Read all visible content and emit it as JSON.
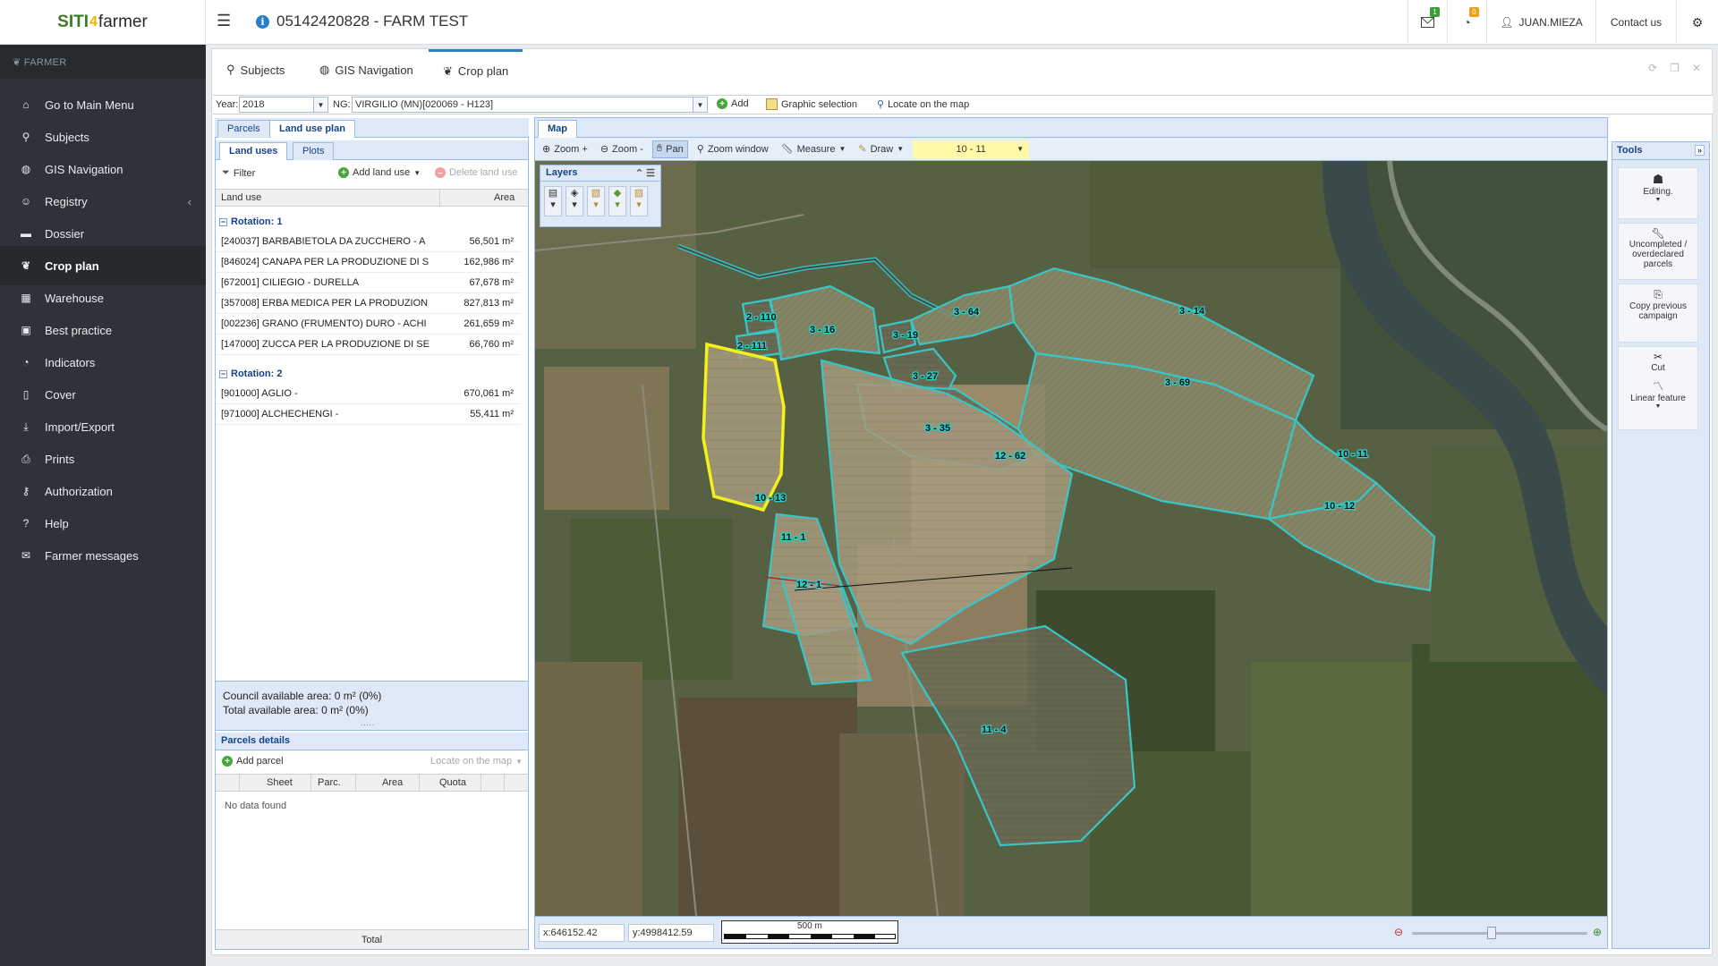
{
  "app": {
    "logo_left": "SITI",
    "logo_mid": "4",
    "logo_right": "farmer",
    "farm_title": "05142420828 - FARM TEST",
    "mail_badge": "1",
    "rss_badge": "0",
    "user": "JUAN.MIEZA",
    "contact": "Contact us"
  },
  "sidebar": {
    "header": "FARMER",
    "items": [
      {
        "label": "Go to Main Menu",
        "icon": "home-icon"
      },
      {
        "label": "Subjects",
        "icon": "search-icon"
      },
      {
        "label": "GIS Navigation",
        "icon": "globe-icon"
      },
      {
        "label": "Registry",
        "icon": "users-icon"
      },
      {
        "label": "Dossier",
        "icon": "folder-icon"
      },
      {
        "label": "Crop plan",
        "icon": "leaf-icon"
      },
      {
        "label": "Warehouse",
        "icon": "warehouse-icon"
      },
      {
        "label": "Best practice",
        "icon": "calendar-check-icon"
      },
      {
        "label": "Indicators",
        "icon": "pie-chart-icon"
      },
      {
        "label": "Cover",
        "icon": "bookmark-icon"
      },
      {
        "label": "Import/Export",
        "icon": "download-icon"
      },
      {
        "label": "Prints",
        "icon": "print-icon"
      },
      {
        "label": "Authorization",
        "icon": "key-icon"
      },
      {
        "label": "Help",
        "icon": "question-icon"
      },
      {
        "label": "Farmer messages",
        "icon": "envelope-icon"
      }
    ]
  },
  "tabs": [
    {
      "label": "Subjects",
      "icon": "search-icon"
    },
    {
      "label": "GIS Navigation",
      "icon": "globe-icon"
    },
    {
      "label": "Crop plan",
      "icon": "leaf-icon"
    }
  ],
  "toolbar": {
    "year_label": "Year:",
    "year_value": "2018",
    "ng_label": "NG:",
    "ng_value": "VIRGILIO (MN)[020069 - H123]",
    "add": "Add",
    "graphic_selection": "Graphic selection",
    "locate": "Locate on the map"
  },
  "left": {
    "tabs": [
      "Parcels",
      "Land use plan"
    ],
    "subtabs": [
      "Land uses",
      "Plots"
    ],
    "filter": "Filter",
    "add_land_use": "Add land use",
    "delete_land_use": "Delete land use",
    "col_land_use": "Land use",
    "col_area": "Area",
    "groups": [
      {
        "title": "Rotation: 1",
        "rows": [
          {
            "land_use": "[240037] BARBABIETOLA DA ZUCCHERO - A",
            "area": "56,501 m²"
          },
          {
            "land_use": "[846024] CANAPA PER LA PRODUZIONE DI S",
            "area": "162,986 m²"
          },
          {
            "land_use": "[672001] CILIEGIO - DURELLA",
            "area": "67,678 m²"
          },
          {
            "land_use": "[357008] ERBA MEDICA PER LA PRODUZION",
            "area": "827,813 m²"
          },
          {
            "land_use": "[002236] GRANO (FRUMENTO) DURO - ACHI",
            "area": "261,659 m²"
          },
          {
            "land_use": "[147000] ZUCCA PER LA PRODUZIONE DI SE",
            "area": "66,760 m²"
          }
        ]
      },
      {
        "title": "Rotation: 2",
        "rows": [
          {
            "land_use": "[901000] AGLIO -",
            "area": "670,061 m²"
          },
          {
            "land_use": "[971000] ALCHECHENGI -",
            "area": "55,411 m²"
          }
        ]
      }
    ],
    "council_area": "Council available area: 0 m² (0%)",
    "total_area": "Total available area: 0 m² (0%)",
    "parcels_details": "Parcels details",
    "add_parcel": "Add parcel",
    "locate_map": "Locate on the map",
    "cols": [
      "Sheet",
      "Parc.",
      "Area",
      "Quota"
    ],
    "no_data": "No data found",
    "total": "Total"
  },
  "map": {
    "tab": "Map",
    "zoom_in": "Zoom +",
    "zoom_out": "Zoom -",
    "pan": "Pan",
    "zoom_window": "Zoom window",
    "measure": "Measure",
    "draw": "Draw",
    "selected": "10 - 11",
    "layers": "Layers",
    "x": "x:646152.42",
    "y": "y:4998412.59",
    "scale": "500 m",
    "zoom_slider_fraction": 0.45,
    "parcels": [
      "2 - 110",
      "2 - 111",
      "3 - 16",
      "3 - 19",
      "3 - 27",
      "3 - 64",
      "3 - 14",
      "3 - 35",
      "3 - 69",
      "10 - 11",
      "10 - 12",
      "10 - 13",
      "11 - 1",
      "12 - 1",
      "12 - 62",
      "11 - 4"
    ]
  },
  "tools": {
    "title": "Tools",
    "editing": "Editing.",
    "uncompleted": "Uncompleted / overdeclared parcels",
    "copy": "Copy previous campaign",
    "cut": "Cut",
    "linear": "Linear feature"
  },
  "colors": {
    "sidebar": "#2d3338",
    "accent": "#2a7fc4",
    "parcel_outline": "#39c6c8",
    "selected_outline": "#f2f21a"
  }
}
